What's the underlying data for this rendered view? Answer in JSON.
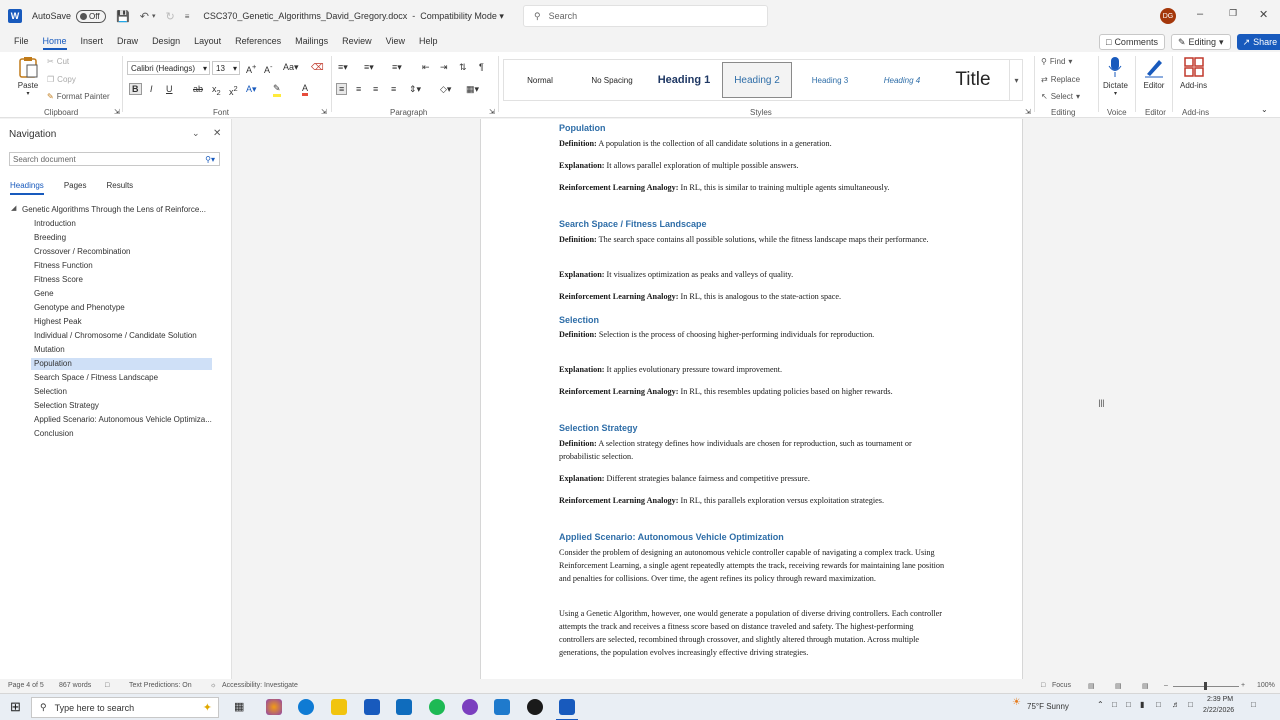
{
  "titlebar": {
    "autosave_label": "AutoSave",
    "autosave_state": "Off",
    "doc_name": "CSC370_Genetic_Algorithms_David_Gregory.docx",
    "mode": "Compatibility Mode",
    "search_placeholder": "Search",
    "avatar": "DG"
  },
  "menu": {
    "tabs": [
      "File",
      "Home",
      "Insert",
      "Draw",
      "Design",
      "Layout",
      "References",
      "Mailings",
      "Review",
      "View",
      "Help"
    ],
    "comments": "Comments",
    "editing": "Editing",
    "share": "Share"
  },
  "ribbon": {
    "clipboard": {
      "paste": "Paste",
      "cut": "Cut",
      "copy": "Copy",
      "format_painter": "Format Painter",
      "label": "Clipboard"
    },
    "font": {
      "family": "Calibri (Headings)",
      "size": "13",
      "label": "Font"
    },
    "paragraph": {
      "label": "Paragraph"
    },
    "styles": {
      "items": [
        "Normal",
        "No Spacing",
        "Heading 1",
        "Heading 2",
        "Heading 3",
        "Heading 4",
        "Title"
      ],
      "label": "Styles"
    },
    "editing": {
      "find": "Find",
      "replace": "Replace",
      "select": "Select",
      "label": "Editing"
    },
    "voice": {
      "dictate": "Dictate",
      "label": "Voice"
    },
    "editor": {
      "editor": "Editor",
      "label": "Editor"
    },
    "addins": {
      "addins": "Add-ins",
      "label": "Add-ins"
    }
  },
  "nav": {
    "title": "Navigation",
    "search_placeholder": "Search document",
    "tabs": [
      "Headings",
      "Pages",
      "Results"
    ],
    "items": [
      "Genetic Algorithms Through the Lens of Reinforce...",
      "Introduction",
      "Breeding",
      "Crossover / Recombination",
      "Fitness Function",
      "Fitness Score",
      "Gene",
      "Genotype and Phenotype",
      "Highest Peak",
      "Individual / Chromosome / Candidate Solution",
      "Mutation",
      "Population",
      "Search Space / Fitness Landscape",
      "Selection",
      "Selection Strategy",
      "Applied Scenario: Autonomous Vehicle Optimiza...",
      "Conclusion"
    ]
  },
  "doc": {
    "s1_heading": "Population",
    "s1_def_label": "Definition:",
    "s1_def": " A population is the collection of all candidate solutions in a generation.",
    "s1_exp_label": "Explanation:",
    "s1_exp": " It allows parallel exploration of multiple possible answers.",
    "s1_rl_label": "Reinforcement Learning Analogy:",
    "s1_rl": " In RL, this is similar to training multiple agents simultaneously.",
    "s2_heading": "Search Space / Fitness Landscape",
    "s2_def_label": "Definition:",
    "s2_def": " The search space contains all possible solutions, while the fitness landscape maps their performance.",
    "s2_exp_label": "Explanation:",
    "s2_exp": " It visualizes optimization as peaks and valleys of quality.",
    "s2_rl_label": "Reinforcement Learning Analogy:",
    "s2_rl": " In RL, this is analogous to the state-action space.",
    "s3_heading": "Selection",
    "s3_def_label": "Definition:",
    "s3_def": " Selection is the process of choosing higher-performing individuals for reproduction.",
    "s3_exp_label": "Explanation:",
    "s3_exp": " It applies evolutionary pressure toward improvement.",
    "s3_rl_label": "Reinforcement Learning Analogy:",
    "s3_rl": " In RL, this resembles updating policies based on higher rewards.",
    "s4_heading": "Selection Strategy",
    "s4_def_label": "Definition:",
    "s4_def": " A selection strategy defines how individuals are chosen for reproduction, such as tournament or probabilistic selection.",
    "s4_exp_label": "Explanation:",
    "s4_exp": " Different strategies balance fairness and competitive pressure.",
    "s4_rl_label": "Reinforcement Learning Analogy:",
    "s4_rl": " In RL, this parallels exploration versus exploitation strategies.",
    "s5_heading": "Applied Scenario: Autonomous Vehicle Optimization",
    "s5_p1": "Consider the problem of designing an autonomous vehicle controller capable of navigating a complex track. Using Reinforcement Learning, a single agent repeatedly attempts the track, receiving rewards for maintaining lane position and penalties for collisions. Over time, the agent refines its policy through reward maximization.",
    "s5_p2": "Using a Genetic Algorithm, however, one would generate a population of diverse driving controllers. Each controller attempts the track and receives a fitness score based on distance traveled and safety. The highest-performing controllers are selected, recombined through crossover, and slightly altered through mutation. Across multiple generations, the population evolves increasingly effective driving strategies."
  },
  "status": {
    "page": "Page 4 of 5",
    "words": "867 words",
    "text_predictions": "Text Predictions: On",
    "accessibility": "Accessibility: Investigate",
    "focus": "Focus",
    "zoom": "100%"
  },
  "taskbar": {
    "search_placeholder": "Type here to search",
    "weather": "75°F  Sunny",
    "time": "2:39 PM",
    "date": "2/22/2026"
  },
  "colors": {
    "accent": "#185abd",
    "heading": "#2f6ea8",
    "nav_selected": "#cfe0f7"
  }
}
